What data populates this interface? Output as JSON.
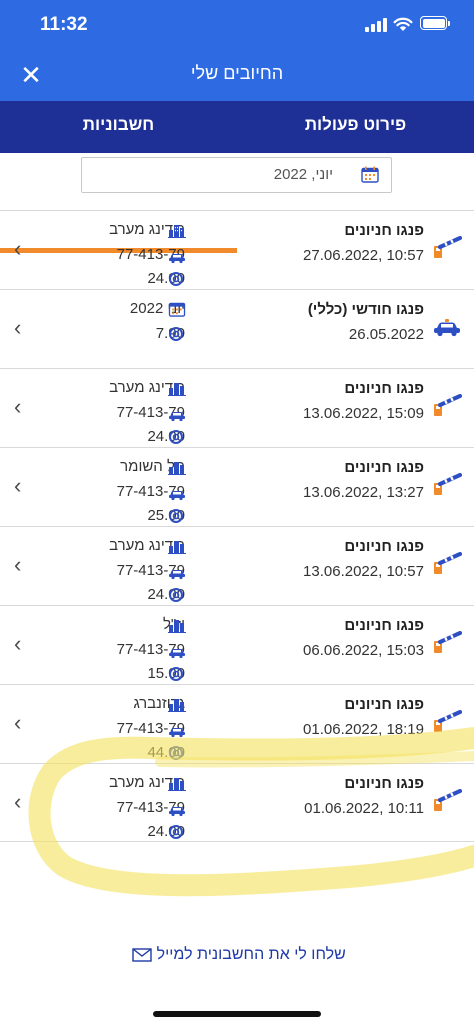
{
  "status_bar": {
    "time": "11:32"
  },
  "header": {
    "title": "החיובים שלי",
    "close_label": "✕"
  },
  "tabs": [
    {
      "label": "חשבוניות",
      "selected": true
    },
    {
      "label": "פירוט פעולות",
      "selected": false
    }
  ],
  "date_filter": {
    "value": "יוני, 2022"
  },
  "items": [
    {
      "title": "פנגו חניונים",
      "date": "27.06.2022, 10:57",
      "location": "רידינג מערב",
      "plate": "77-413-79",
      "amount": "24.00",
      "type_icon": "parking-barrier-icon",
      "loc_icon": "city-icon"
    },
    {
      "title": "פנגו חודשי (כללי)",
      "date": "26.05.2022",
      "location": "יוני 2022",
      "plate": "",
      "amount": "7.90",
      "type_icon": "car-icon",
      "loc_icon": "calendar-icon"
    },
    {
      "title": "פנגו חניונים",
      "date": "13.06.2022, 15:09",
      "location": "רידינג מערב",
      "plate": "77-413-79",
      "amount": "24.00",
      "type_icon": "parking-barrier-icon",
      "loc_icon": "city-icon"
    },
    {
      "title": "פנגו חניונים",
      "date": "13.06.2022, 13:27",
      "location": "תל השומר",
      "plate": "77-413-79",
      "amount": "25.00",
      "type_icon": "parking-barrier-icon",
      "loc_icon": "city-icon"
    },
    {
      "title": "פנגו חניונים",
      "date": "13.06.2022, 10:57",
      "location": "רידינג מערב",
      "plate": "77-413-79",
      "amount": "24.00",
      "type_icon": "parking-barrier-icon",
      "loc_icon": "city-icon"
    },
    {
      "title": "פנגו חניונים",
      "date": "06.06.2022, 15:03",
      "location": "וז\"ל",
      "plate": "77-413-79",
      "amount": "15.00",
      "type_icon": "parking-barrier-icon",
      "loc_icon": "city-icon"
    },
    {
      "title": "פנגו חניונים",
      "date": "01.06.2022, 18:19",
      "location": "גרוזנברג",
      "plate": "77-413-79",
      "amount": "44.00",
      "type_icon": "parking-barrier-icon",
      "loc_icon": "city-icon"
    },
    {
      "title": "פנגו חניונים",
      "date": "01.06.2022, 10:11",
      "location": "רידינג מערב",
      "plate": "77-413-79",
      "amount": "24.00",
      "type_icon": "parking-barrier-icon",
      "loc_icon": "city-icon"
    }
  ],
  "footer": {
    "email_link": "שלחו לי את החשבונית למייל"
  },
  "colors": {
    "header_blue": "#2e6be3",
    "tab_navy": "#1e2f96",
    "tab_underline_orange": "#f08a2a",
    "icon_blue": "#2e4fc4",
    "highlighter_yellow": "#f3e15a"
  }
}
